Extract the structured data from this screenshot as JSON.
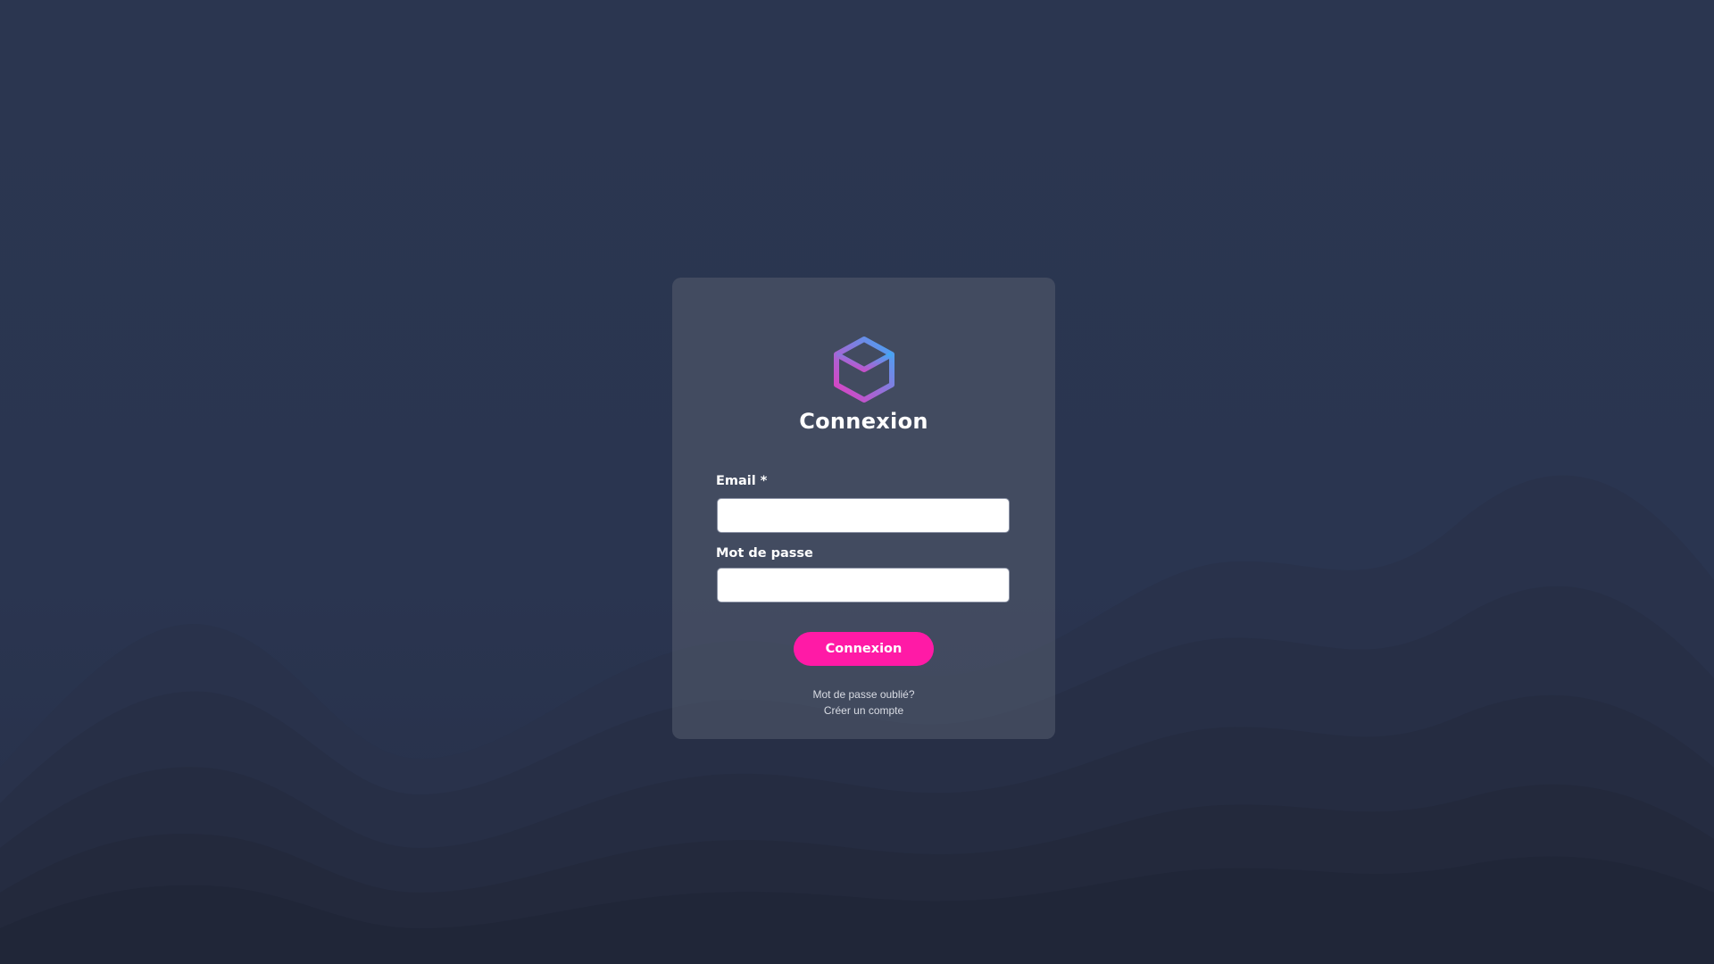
{
  "login": {
    "title": "Connexion",
    "email_label": "Email *",
    "email_value": "",
    "password_label": "Mot de passe",
    "password_value": "",
    "submit_label": "Connexion",
    "forgot_password_link": "Mot de passe oublié?",
    "create_account_link": "Créer un compte"
  },
  "icons": {
    "logo": "cube-logo-icon"
  },
  "colors": {
    "background": "#2a3550",
    "card": "#4a5266",
    "accent": "#ff1aa6",
    "logo_gradient_start": "#e63bbf",
    "logo_gradient_end": "#3fa9f5",
    "text": "#ffffff"
  }
}
